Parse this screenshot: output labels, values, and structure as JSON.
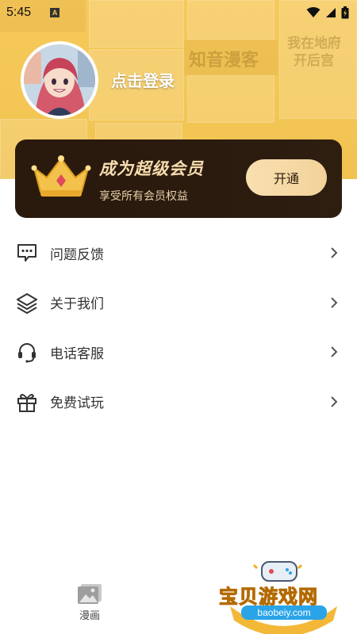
{
  "status_bar": {
    "time": "5:45",
    "notification_badge": "A"
  },
  "header": {
    "background_texts": [
      "知音漫客",
      "我在地府",
      "开后宫"
    ],
    "login_label": "点击登录"
  },
  "vip": {
    "title": "成为超级会员",
    "subtitle": "享受所有会员权益",
    "button_label": "开通",
    "colors": {
      "card": "#2a1a0d",
      "title": "#f6dcae",
      "button": "#f6dba6"
    }
  },
  "menu": {
    "items": [
      {
        "label": "问题反馈",
        "icon": "feedback-icon"
      },
      {
        "label": "关于我们",
        "icon": "layers-icon"
      },
      {
        "label": "电话客服",
        "icon": "headset-icon"
      },
      {
        "label": "免费试玩",
        "icon": "gift-icon"
      }
    ]
  },
  "bottom_nav": {
    "tabs": [
      {
        "label": "漫画",
        "icon": "comic-icon"
      }
    ]
  },
  "watermark": {
    "title": "宝贝游戏网",
    "url": "baobeiy.com"
  },
  "theme": {
    "header_yellow": "#f3c655"
  }
}
